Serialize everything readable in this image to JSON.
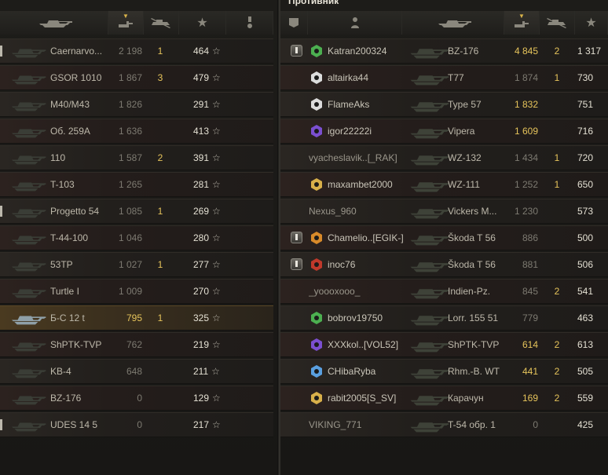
{
  "right_title": "Противник",
  "left_rows": [
    {
      "tank": "Caernarvo...",
      "damage": "2 198",
      "kills": "1",
      "xp": "464",
      "player": false,
      "platoon": true
    },
    {
      "tank": "GSOR 1010",
      "damage": "1 867",
      "kills": "3",
      "xp": "479",
      "player": false,
      "platoon": false
    },
    {
      "tank": "M40/M43",
      "damage": "1 826",
      "kills": "",
      "xp": "291",
      "player": false,
      "platoon": false
    },
    {
      "tank": "Об. 259А",
      "damage": "1 636",
      "kills": "",
      "xp": "413",
      "player": false,
      "platoon": false
    },
    {
      "tank": "110",
      "damage": "1 587",
      "kills": "2",
      "xp": "391",
      "player": false,
      "platoon": false
    },
    {
      "tank": "T-103",
      "damage": "1 265",
      "kills": "",
      "xp": "281",
      "player": false,
      "platoon": false
    },
    {
      "tank": "Progetto 54",
      "damage": "1 085",
      "kills": "1",
      "xp": "269",
      "player": false,
      "platoon": true
    },
    {
      "tank": "T-44-100",
      "damage": "1 046",
      "kills": "",
      "xp": "280",
      "player": false,
      "platoon": false
    },
    {
      "tank": "53TP",
      "damage": "1 027",
      "kills": "1",
      "xp": "277",
      "player": false,
      "platoon": false
    },
    {
      "tank": "Turtle I",
      "damage": "1 009",
      "kills": "",
      "xp": "270",
      "player": false,
      "platoon": false
    },
    {
      "tank": "Б-С 12 t",
      "damage": "795",
      "kills": "1",
      "xp": "325",
      "player": true,
      "platoon": false
    },
    {
      "tank": "ShPTK-TVP",
      "damage": "762",
      "kills": "",
      "xp": "219",
      "player": false,
      "platoon": false
    },
    {
      "tank": "KB-4",
      "damage": "648",
      "kills": "",
      "xp": "211",
      "player": false,
      "platoon": false
    },
    {
      "tank": "BZ-176",
      "damage": "0",
      "kills": "",
      "xp": "129",
      "player": false,
      "platoon": false
    },
    {
      "tank": "UDES 14 5",
      "damage": "0",
      "kills": "",
      "xp": "217",
      "player": false,
      "platoon": true
    }
  ],
  "right_rows": [
    {
      "player": "Katran200324",
      "tank": "BZ-176",
      "damage": "4 845",
      "kills": "2",
      "xp": "1 317",
      "hi": true,
      "platoon": true,
      "clan": "green"
    },
    {
      "player": "altairka44",
      "tank": "T77",
      "damage": "1 874",
      "kills": "1",
      "xp": "730",
      "hi": false,
      "platoon": false,
      "clan": "white"
    },
    {
      "player": "FlameAks",
      "tank": "Type 57",
      "damage": "1 832",
      "kills": "",
      "xp": "751",
      "hi": true,
      "platoon": false,
      "clan": "white"
    },
    {
      "player": "igor22222i",
      "tank": "Vipera",
      "damage": "1 609",
      "kills": "",
      "xp": "716",
      "hi": true,
      "platoon": false,
      "clan": "purple"
    },
    {
      "player": "vyacheslavik..[_RAK]",
      "tank": "WZ-132",
      "damage": "1 434",
      "kills": "1",
      "xp": "720",
      "hi": false,
      "platoon": false,
      "clan": ""
    },
    {
      "player": "maxambet2000",
      "tank": "WZ-111",
      "damage": "1 252",
      "kills": "1",
      "xp": "650",
      "hi": false,
      "platoon": false,
      "clan": "gold"
    },
    {
      "player": "Nexus_960",
      "tank": "Vickers M...",
      "damage": "1 230",
      "kills": "",
      "xp": "573",
      "hi": false,
      "platoon": false,
      "clan": ""
    },
    {
      "player": "Chamelio..[EGIK-]",
      "tank": "Škoda T 56",
      "damage": "886",
      "kills": "",
      "xp": "500",
      "hi": false,
      "platoon": true,
      "clan": "orange"
    },
    {
      "player": "inoc76",
      "tank": "Škoda T 56",
      "damage": "881",
      "kills": "",
      "xp": "506",
      "hi": false,
      "platoon": true,
      "clan": "red"
    },
    {
      "player": "_yoooxooo_",
      "tank": "Indien-Pz.",
      "damage": "845",
      "kills": "2",
      "xp": "541",
      "hi": false,
      "platoon": false,
      "clan": ""
    },
    {
      "player": "bobrov19750",
      "tank": "Lorr. 155 51",
      "damage": "779",
      "kills": "",
      "xp": "463",
      "hi": false,
      "platoon": false,
      "clan": "green"
    },
    {
      "player": "XXXkol..[VOL52]",
      "tank": "ShPTK-TVP",
      "damage": "614",
      "kills": "2",
      "xp": "613",
      "hi": true,
      "platoon": false,
      "clan": "purple"
    },
    {
      "player": "CHibaRyba",
      "tank": "Rhm.-B. WT",
      "damage": "441",
      "kills": "2",
      "xp": "505",
      "hi": true,
      "platoon": false,
      "clan": "blue"
    },
    {
      "player": "rabit2005[S_SV]",
      "tank": "Карачун",
      "damage": "169",
      "kills": "2",
      "xp": "559",
      "hi": true,
      "platoon": false,
      "clan": "gold"
    },
    {
      "player": "VIKING_771",
      "tank": "T-54 обр. 1",
      "damage": "0",
      "kills": "",
      "xp": "425",
      "hi": false,
      "platoon": false,
      "clan": ""
    }
  ],
  "colors": {
    "accent_gold": "#e6c45b",
    "text": "#c9c5b8",
    "player_row": "#4a3a20"
  },
  "icons": [
    "tank-icon",
    "damage-icon",
    "kills-icon",
    "star-icon",
    "medal-icon",
    "platoon-icon",
    "player-icon"
  ]
}
